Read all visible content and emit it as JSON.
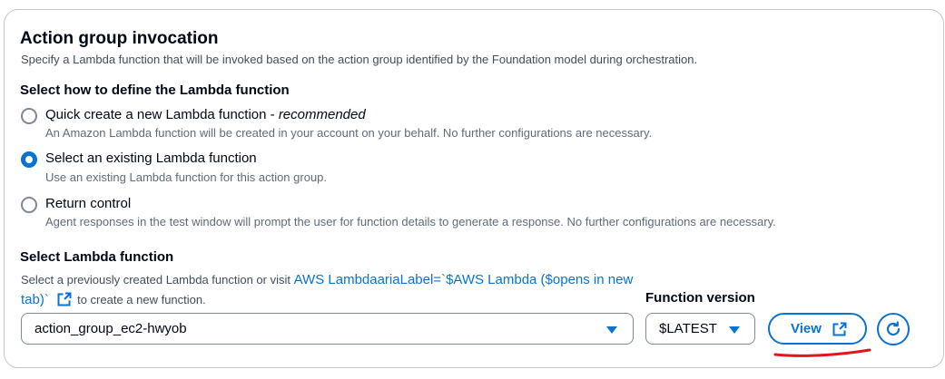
{
  "section": {
    "title": "Action group invocation",
    "description": "Specify a Lambda function that will be invoked based on the action group identified by the Foundation model during orchestration."
  },
  "define": {
    "heading": "Select how to define the Lambda function",
    "options": [
      {
        "label": "Quick create a new Lambda function - ",
        "label_emphasis": "recommended",
        "description": "An Amazon Lambda function will be created in your account on your behalf. No further configurations are necessary.",
        "checked": false
      },
      {
        "label": "Select an existing Lambda function",
        "description": "Use an existing Lambda function for this action group.",
        "checked": true
      },
      {
        "label": "Return control",
        "description": "Agent responses in the test window will prompt the user for function details to generate a response. No further configurations are necessary.",
        "checked": false
      }
    ]
  },
  "lambda": {
    "heading": "Select Lambda function",
    "desc_prefix": "Select a previously created Lambda function or visit ",
    "link_text": "AWS LambdaariaLabel=`$AWS Lambda ($opens in new tab)`",
    "desc_suffix": "to create a new function.",
    "selected_function": "action_group_ec2-hwyob"
  },
  "version": {
    "heading": "Function version",
    "selected": "$LATEST"
  },
  "buttons": {
    "view_label": "View"
  },
  "icons": {
    "external_link": "external-link-icon",
    "caret": "caret-down-icon",
    "refresh": "refresh-icon"
  },
  "colors": {
    "accent": "#0972d3",
    "annotation_underline": "#e0161d"
  }
}
